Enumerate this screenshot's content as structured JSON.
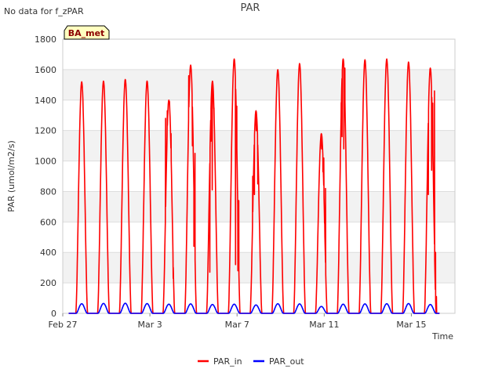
{
  "chart_data": {
    "type": "line",
    "title": "PAR",
    "note": "No data for f_zPAR",
    "badge": "BA_met",
    "xlabel": "Time",
    "ylabel": "PAR (umol/m2/s)",
    "x_unit": "days",
    "xlim": [
      0,
      18
    ],
    "ylim": [
      0,
      1800
    ],
    "y_ticks": [
      0,
      200,
      400,
      600,
      800,
      1000,
      1200,
      1400,
      1600,
      1800
    ],
    "x_ticks": [
      {
        "value": 0,
        "label": "Feb 27"
      },
      {
        "value": 4,
        "label": "Mar 3"
      },
      {
        "value": 8,
        "label": "Mar 7"
      },
      {
        "value": 12,
        "label": "Mar 11"
      },
      {
        "value": 16,
        "label": "Mar 15"
      }
    ],
    "grid": true,
    "legend_position": "bottom",
    "series": [
      {
        "name": "PAR_in",
        "color": "#ff0000",
        "days": [
          {
            "center": 0.87,
            "peak": 1520,
            "spikes": []
          },
          {
            "center": 1.87,
            "peak": 1525,
            "spikes": []
          },
          {
            "center": 2.87,
            "peak": 1535,
            "spikes": []
          },
          {
            "center": 3.87,
            "peak": 1525,
            "spikes": []
          },
          {
            "center": 4.87,
            "peak": 1400,
            "spikes": [
              [
                4.72,
                1280
              ],
              [
                4.8,
                1330
              ],
              [
                4.9,
                1390
              ],
              [
                4.97,
                1180
              ],
              [
                5.07,
                230
              ]
            ]
          },
          {
            "center": 5.87,
            "peak": 1630,
            "spikes": [
              [
                5.78,
                1560
              ],
              [
                5.95,
                1100
              ],
              [
                6.02,
                440
              ],
              [
                6.07,
                1050
              ]
            ]
          },
          {
            "center": 6.87,
            "peak": 1525,
            "spikes": [
              [
                6.75,
                270
              ],
              [
                6.8,
                1130
              ],
              [
                6.86,
                810
              ],
              [
                6.94,
                1350
              ]
            ]
          },
          {
            "center": 7.87,
            "peak": 1670,
            "spikes": [
              [
                7.93,
                320
              ],
              [
                7.99,
                1360
              ],
              [
                8.04,
                280
              ],
              [
                8.08,
                740
              ]
            ]
          },
          {
            "center": 8.87,
            "peak": 1330,
            "spikes": [
              [
                8.72,
                900
              ],
              [
                8.8,
                780
              ],
              [
                8.88,
                1200
              ],
              [
                8.95,
                850
              ]
            ]
          },
          {
            "center": 9.87,
            "peak": 1600,
            "spikes": []
          },
          {
            "center": 10.87,
            "peak": 1640,
            "spikes": []
          },
          {
            "center": 11.87,
            "peak": 1180,
            "spikes": [
              [
                11.88,
                1080
              ],
              [
                11.94,
                930
              ],
              [
                11.98,
                1020
              ],
              [
                12.02,
                640
              ],
              [
                12.06,
                820
              ]
            ]
          },
          {
            "center": 12.87,
            "peak": 1670,
            "spikes": [
              [
                12.78,
                1380
              ],
              [
                12.82,
                1160
              ],
              [
                12.9,
                1080
              ],
              [
                12.95,
                1610
              ]
            ]
          },
          {
            "center": 13.87,
            "peak": 1665,
            "spikes": []
          },
          {
            "center": 14.87,
            "peak": 1670,
            "spikes": []
          },
          {
            "center": 15.87,
            "peak": 1650,
            "spikes": []
          },
          {
            "center": 16.87,
            "peak": 1610,
            "spikes": [
              [
                16.78,
                780
              ],
              [
                16.93,
                940
              ],
              [
                16.98,
                1380
              ],
              [
                17.06,
                1460
              ],
              [
                17.11,
                400
              ],
              [
                17.15,
                110
              ]
            ]
          }
        ]
      },
      {
        "name": "PAR_out",
        "color": "#0000ff",
        "days": [
          {
            "center": 0.87,
            "peak": 63
          },
          {
            "center": 1.87,
            "peak": 65
          },
          {
            "center": 2.87,
            "peak": 66
          },
          {
            "center": 3.87,
            "peak": 64
          },
          {
            "center": 4.87,
            "peak": 60
          },
          {
            "center": 5.87,
            "peak": 62
          },
          {
            "center": 6.87,
            "peak": 58
          },
          {
            "center": 7.87,
            "peak": 60
          },
          {
            "center": 8.87,
            "peak": 55
          },
          {
            "center": 9.87,
            "peak": 63
          },
          {
            "center": 10.87,
            "peak": 62
          },
          {
            "center": 11.87,
            "peak": 45
          },
          {
            "center": 12.87,
            "peak": 60
          },
          {
            "center": 13.87,
            "peak": 62
          },
          {
            "center": 14.87,
            "peak": 63
          },
          {
            "center": 15.87,
            "peak": 64
          },
          {
            "center": 16.87,
            "peak": 58
          }
        ]
      }
    ]
  }
}
